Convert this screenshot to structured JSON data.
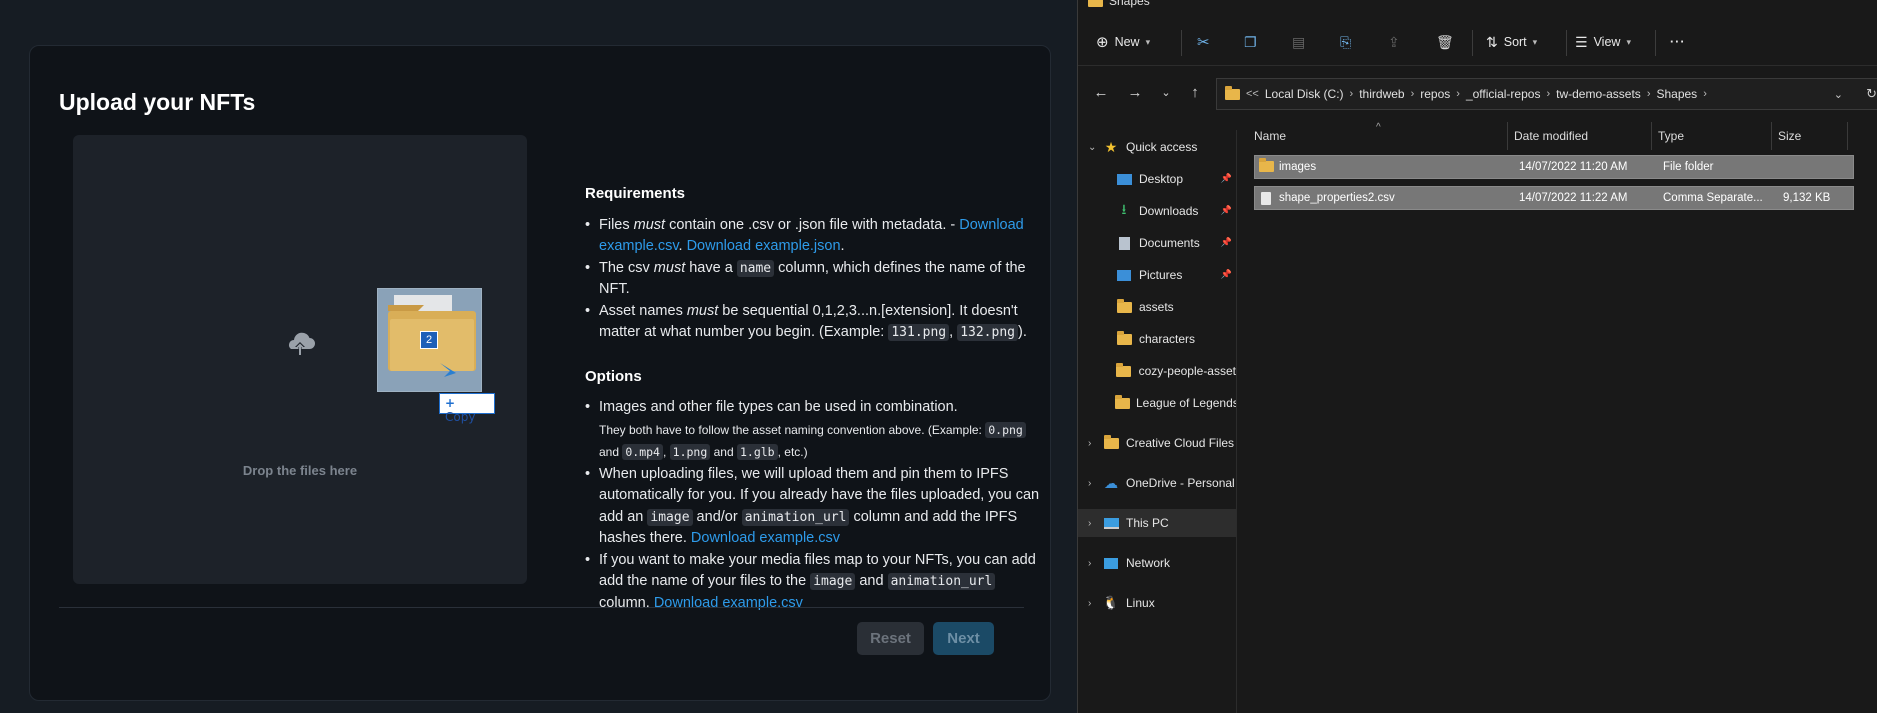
{
  "upload": {
    "title": "Upload your NFTs",
    "drop_text": "Drop the files here",
    "drag_badge_count": "2",
    "copy_label": "Copy",
    "requirements_heading": "Requirements",
    "req1": {
      "pre": "Files ",
      "em": "must",
      "post": " contain one .csv or .json file with metadata. -",
      "link1": "Download example.csv",
      "mid": ". ",
      "link2": "Download example.json",
      "end": "."
    },
    "req2": {
      "pre": "The csv ",
      "em": "must",
      "mid": " have a ",
      "code": "name",
      "post": " column, which defines the name of the NFT."
    },
    "req3": {
      "pre": "Asset names ",
      "em": "must",
      "post": " be sequential 0,1,2,3...n.[extension]. It doesn't matter at what number you begin. (Example: ",
      "code1": "131.png",
      "sep": ", ",
      "code2": "132.png",
      "end": ")."
    },
    "options_heading": "Options",
    "opt1": {
      "main": "Images and other file types can be used in combination.",
      "small_pre": "They both have to follow the asset naming convention above. (Example: ",
      "code1": "0.png",
      "and1": " and ",
      "code2": "0.mp4",
      "sep": ", ",
      "code3": "1.png",
      "and2": " and ",
      "code4": "1.glb",
      "end": ", etc.)"
    },
    "opt2": {
      "pre": "When uploading files, we will upload them and pin them to IPFS automatically for you. If you already have the files uploaded, you can add an ",
      "code1": "image",
      "mid": " and/or ",
      "code2": "animation_url",
      "post": " column and add the IPFS hashes there. ",
      "link": "Download example.csv"
    },
    "opt3": {
      "pre": "If you want to make your media files map to your NFTs, you can add add the name of your files to the ",
      "code1": "image",
      "mid": " and ",
      "code2": "animation_url",
      "post": " column. ",
      "link": "Download example.csv"
    },
    "reset_label": "Reset",
    "next_label": "Next"
  },
  "explorer": {
    "window_title": "Shapes",
    "toolbar": {
      "new_label": "New",
      "sort_label": "Sort",
      "view_label": "View",
      "more_label": "···"
    },
    "address": [
      "Local Disk (C:)",
      "thirdweb",
      "repos",
      "_official-repos",
      "tw-demo-assets",
      "Shapes"
    ],
    "address_overflow": "<<",
    "columns": {
      "name": "Name",
      "date": "Date modified",
      "type": "Type",
      "size": "Size"
    },
    "files": [
      {
        "name": "images",
        "date": "14/07/2022 11:20 AM",
        "type": "File folder",
        "size": ""
      },
      {
        "name": "shape_properties2.csv",
        "date": "14/07/2022 11:22 AM",
        "type": "Comma Separate...",
        "size": "9,132 KB"
      }
    ],
    "sidebar": {
      "quick_access": "Quick access",
      "pinned": [
        "Desktop",
        "Downloads",
        "Documents",
        "Pictures"
      ],
      "folders": [
        "assets",
        "characters",
        "cozy-people-asset",
        "League of Legends"
      ],
      "creative_cloud": "Creative Cloud Files",
      "onedrive": "OneDrive - Personal",
      "this_pc": "This PC",
      "network": "Network",
      "linux": "Linux"
    }
  }
}
